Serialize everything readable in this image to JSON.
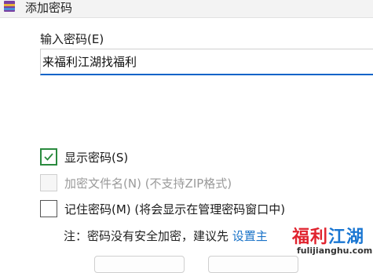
{
  "window": {
    "title": "添加密码",
    "icon": "winrar-icon"
  },
  "password": {
    "label": "输入密码(E)",
    "value": "来福利江湖找福利"
  },
  "options": [
    {
      "label": "显示密码(S)",
      "checked": true,
      "disabled": false
    },
    {
      "label": "加密文件名(N) (不支持ZIP格式)",
      "checked": false,
      "disabled": true
    },
    {
      "label": "记住密码(M) (将会显示在管理密码窗口中)",
      "checked": false,
      "disabled": false
    }
  ],
  "note": {
    "text": "注：密码没有安全加密，建议先 ",
    "link": "设置主"
  },
  "watermark": {
    "title_part1": "福利",
    "title_part2": "江湖",
    "url": "fulijianghu.com"
  },
  "colors": {
    "accent": "#0a64c8",
    "check": "#2a8a3e",
    "link": "#1a73c8"
  }
}
